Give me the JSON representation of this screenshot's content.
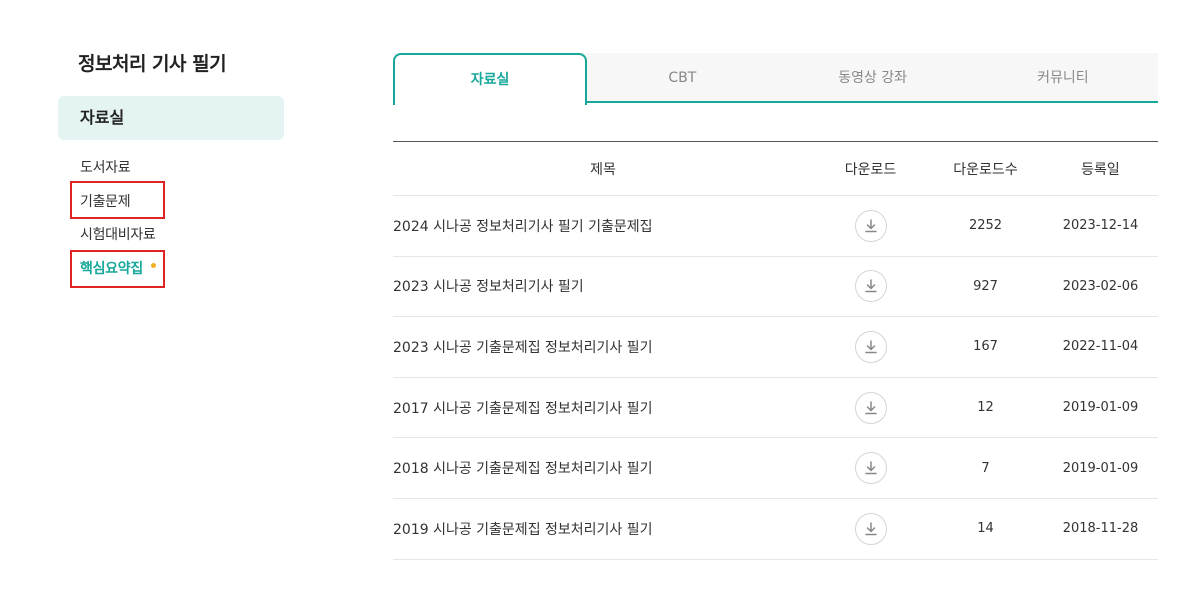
{
  "sidebar": {
    "title": "정보처리 기사 필기",
    "section": "자료실",
    "items": [
      {
        "label": "도서자료"
      },
      {
        "label": "기출문제"
      },
      {
        "label": "시험대비자료"
      },
      {
        "label": "핵심요약집"
      }
    ]
  },
  "tabs": [
    {
      "label": "자료실"
    },
    {
      "label": "CBT"
    },
    {
      "label": "동영상 강좌"
    },
    {
      "label": "커뮤니티"
    }
  ],
  "table": {
    "headers": {
      "title": "제목",
      "download": "다운로드",
      "count": "다운로드수",
      "date": "등록일"
    },
    "rows": [
      {
        "title": "2024 시나공 정보처리기사 필기 기출문제집",
        "count": "2252",
        "date": "2023-12-14"
      },
      {
        "title": "2023 시나공 정보처리기사 필기",
        "count": "927",
        "date": "2023-02-06"
      },
      {
        "title": "2023 시나공 기출문제집 정보처리기사 필기",
        "count": "167",
        "date": "2022-11-04"
      },
      {
        "title": "2017 시나공 기출문제집 정보처리기사 필기",
        "count": "12",
        "date": "2019-01-09"
      },
      {
        "title": "2018 시나공 기출문제집 정보처리기사 필기",
        "count": "7",
        "date": "2019-01-09"
      },
      {
        "title": "2019 시나공 기출문제집 정보처리기사 필기",
        "count": "14",
        "date": "2018-11-28"
      }
    ]
  },
  "colors": {
    "accent": "#18a89b",
    "highlight": "#e02424",
    "dot": "#f2b01e"
  }
}
